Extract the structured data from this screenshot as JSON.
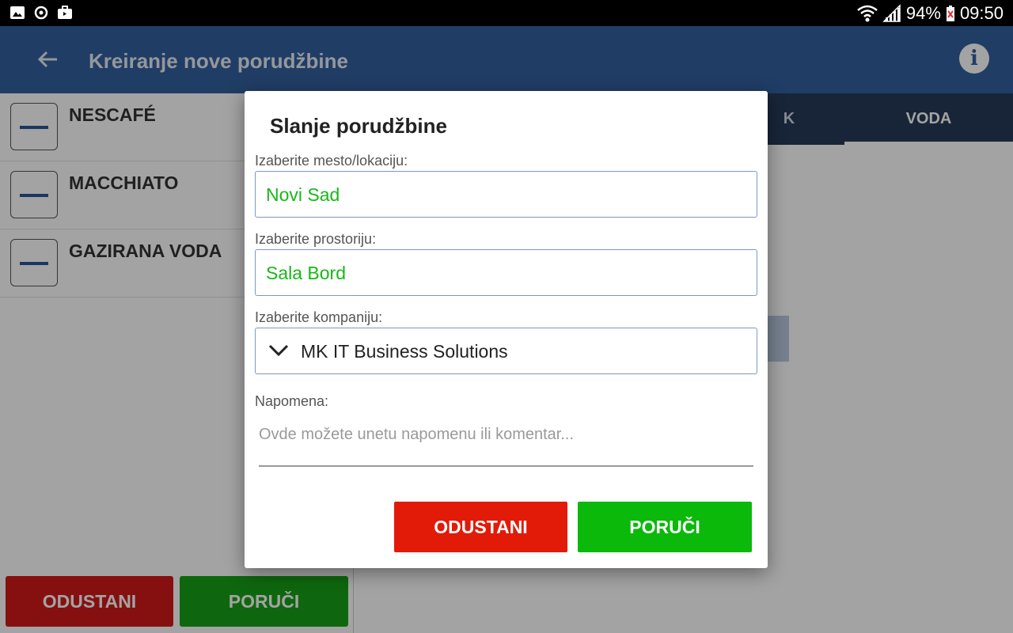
{
  "status_bar": {
    "battery": "94%",
    "time": "09:50",
    "icons": [
      "gallery-icon",
      "sync-icon",
      "briefcase-icon",
      "wifi-icon",
      "signal-icon",
      "battery-icon"
    ]
  },
  "app_bar": {
    "title": "Kreiranje nove porudžbine",
    "back_icon": "back-arrow-icon",
    "info_icon": "info-icon"
  },
  "list": {
    "items": [
      {
        "name": "NESCAFÉ"
      },
      {
        "name": "MACCHIATO"
      },
      {
        "name": "GAZIRANA VODA"
      }
    ],
    "cancel_label": "ODUSTANI",
    "order_label": "PORUČI"
  },
  "tabs": {
    "items": [
      {
        "label": "K"
      },
      {
        "label": "VODA"
      }
    ],
    "selected": "VODA"
  },
  "dialog": {
    "title": "Slanje porudžbine",
    "location": {
      "label": "Izaberite mesto/lokaciju:",
      "value": "Novi Sad"
    },
    "room": {
      "label": "Izaberite prostoriju:",
      "value": "Sala Bord"
    },
    "company": {
      "label": "Izaberite kompaniju:",
      "value": "MK IT Business Solutions"
    },
    "note": {
      "label": "Napomena:",
      "placeholder": "Ovde možete unetu napomenu ili komentar..."
    },
    "cancel_label": "ODUSTANI",
    "order_label": "PORUČI"
  },
  "colors": {
    "app_bar": "#33609f",
    "tabs_bar": "#263a5a",
    "value_green": "#17b817",
    "cancel_red": "#e21a08",
    "order_green": "#0bb90b"
  }
}
